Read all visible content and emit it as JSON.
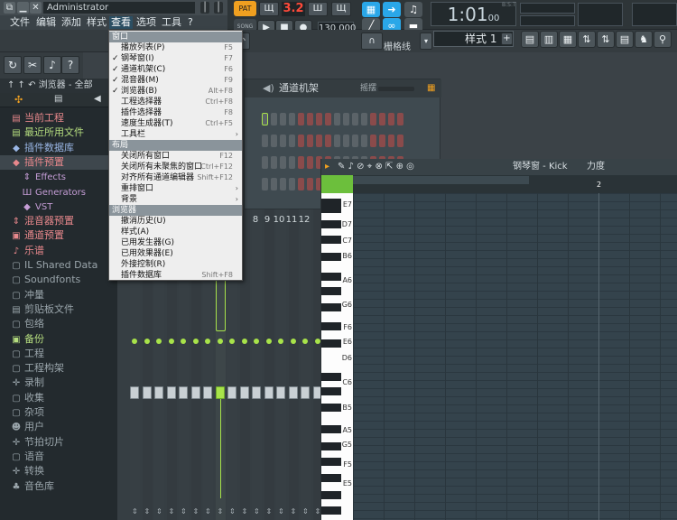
{
  "window": {
    "title": "Administrator"
  },
  "menubar": {
    "items": [
      "文件",
      "编辑",
      "添加",
      "样式",
      "查看",
      "选项",
      "工具",
      "?"
    ],
    "active": "查看"
  },
  "transport": {
    "pattern_label": "PAT",
    "song_label": "SONG",
    "tempo": "130.000",
    "pattern_number": "3.2",
    "time": "1:01",
    "time_small": "00",
    "time_caption": "B:S:T"
  },
  "snap": {
    "label": "栅格线"
  },
  "pattern_selector": {
    "label": "样式 1"
  },
  "browser": {
    "header": "浏览器 - 全部",
    "items": [
      {
        "label": "当前工程",
        "icon": "project-icon",
        "glyph": "▤",
        "color": "#e8888c"
      },
      {
        "label": "最近所用文件",
        "icon": "recent-files-icon",
        "glyph": "▤",
        "color": "#b5dd7f"
      },
      {
        "label": "插件数据库",
        "icon": "plugin-db-icon",
        "glyph": "◆",
        "color": "#9ab7e6"
      },
      {
        "label": "插件预置",
        "icon": "plugin-preset-icon",
        "glyph": "◆",
        "color": "#e8888c"
      },
      {
        "label": "Effects",
        "icon": "effects-icon",
        "glyph": "⇕",
        "color": "#c59dd6",
        "indent": true
      },
      {
        "label": "Generators",
        "icon": "generators-icon",
        "glyph": "Ш",
        "color": "#c59dd6",
        "indent": true
      },
      {
        "label": "VST",
        "icon": "vst-icon",
        "glyph": "◆",
        "color": "#c59dd6",
        "indent": true
      },
      {
        "label": "混音器预置",
        "icon": "mixer-preset-icon",
        "glyph": "⇕",
        "color": "#e8888c"
      },
      {
        "label": "通道预置",
        "icon": "channel-preset-icon",
        "glyph": "▣",
        "color": "#e8888c"
      },
      {
        "label": "乐谱",
        "icon": "score-icon",
        "glyph": "♪",
        "color": "#e8888c"
      },
      {
        "label": "IL Shared Data",
        "icon": "folder-icon",
        "glyph": "▢",
        "color": "#9aa5ab"
      },
      {
        "label": "Soundfonts",
        "icon": "folder-icon",
        "glyph": "▢",
        "color": "#9aa5ab"
      },
      {
        "label": "冲量",
        "icon": "folder-icon",
        "glyph": "▢",
        "color": "#9aa5ab"
      },
      {
        "label": "剪贴板文件",
        "icon": "clipboard-icon",
        "glyph": "▤",
        "color": "#9aa5ab"
      },
      {
        "label": "包络",
        "icon": "folder-icon",
        "glyph": "▢",
        "color": "#9aa5ab"
      },
      {
        "label": "备份",
        "icon": "backup-icon",
        "glyph": "▣",
        "color": "#b5dd7f"
      },
      {
        "label": "工程",
        "icon": "folder-icon",
        "glyph": "▢",
        "color": "#9aa5ab"
      },
      {
        "label": "工程构架",
        "icon": "folder-icon",
        "glyph": "▢",
        "color": "#9aa5ab"
      },
      {
        "label": "录制",
        "icon": "record-icon",
        "glyph": "✛",
        "color": "#9aa5ab"
      },
      {
        "label": "收集",
        "icon": "folder-icon",
        "glyph": "▢",
        "color": "#9aa5ab"
      },
      {
        "label": "杂项",
        "icon": "folder-icon",
        "glyph": "▢",
        "color": "#9aa5ab"
      },
      {
        "label": "用户",
        "icon": "user-icon",
        "glyph": "☻",
        "color": "#9aa5ab"
      },
      {
        "label": "节拍切片",
        "icon": "slice-icon",
        "glyph": "✛",
        "color": "#9aa5ab"
      },
      {
        "label": "语音",
        "icon": "folder-icon",
        "glyph": "▢",
        "color": "#9aa5ab"
      },
      {
        "label": "转换",
        "icon": "convert-icon",
        "glyph": "✛",
        "color": "#9aa5ab"
      },
      {
        "label": "音色库",
        "icon": "sound-library-icon",
        "glyph": "♣",
        "color": "#9aa5ab"
      }
    ]
  },
  "channel_rack": {
    "title": "通道机架",
    "swing": "摇摆"
  },
  "mixer": {
    "track_numbers": [
      "8",
      "9",
      "10",
      "11",
      "12"
    ]
  },
  "piano_roll": {
    "title": "钢琴窗 - Kick",
    "velocity": "力度",
    "bar_marker": "2",
    "note_labels": [
      "E7",
      "D7",
      "C7",
      "B6",
      "A6",
      "G6",
      "F6",
      "E6",
      "D6",
      "C6",
      "B5",
      "A5",
      "G5",
      "F5",
      "E5"
    ]
  },
  "dropdown": {
    "sections": [
      {
        "title": "窗口",
        "items": [
          {
            "label": "播放列表(P)",
            "shortcut": "F5",
            "checked": false
          },
          {
            "label": "钢琴窗(I)",
            "shortcut": "F7",
            "checked": true
          },
          {
            "label": "通道机架(C)",
            "shortcut": "F6",
            "checked": true
          },
          {
            "label": "混音器(M)",
            "shortcut": "F9",
            "checked": true
          },
          {
            "label": "浏览器(B)",
            "shortcut": "Alt+F8",
            "checked": true
          },
          {
            "label": "工程选择器",
            "shortcut": "Ctrl+F8",
            "checked": false
          },
          {
            "label": "插件选择器",
            "shortcut": "F8",
            "checked": false
          },
          {
            "label": "速度生成器(T)",
            "shortcut": "Ctrl+F5",
            "checked": false
          },
          {
            "label": "工具栏",
            "shortcut": "",
            "checked": false,
            "submenu": true
          }
        ]
      },
      {
        "title": "布局",
        "items": [
          {
            "label": "关闭所有窗口",
            "shortcut": "F12",
            "checked": false
          },
          {
            "label": "关闭所有未聚焦的窗口",
            "shortcut": "Ctrl+F12",
            "checked": false
          },
          {
            "label": "对齐所有通道编辑器",
            "shortcut": "Shift+F12",
            "checked": false
          },
          {
            "label": "重排窗口",
            "shortcut": "",
            "checked": false,
            "submenu": true
          },
          {
            "label": "背景",
            "shortcut": "",
            "checked": false,
            "submenu": true
          }
        ]
      },
      {
        "title": "浏览器",
        "items": [
          {
            "label": "撤消历史(U)",
            "shortcut": "",
            "checked": false
          },
          {
            "label": "样式(A)",
            "shortcut": "",
            "checked": false
          },
          {
            "label": "已用发生器(G)",
            "shortcut": "",
            "checked": false
          },
          {
            "label": "已用效果器(E)",
            "shortcut": "",
            "checked": false
          },
          {
            "label": "外接控制(R)",
            "shortcut": "",
            "checked": false
          },
          {
            "label": "插件数据库",
            "shortcut": "Shift+F8",
            "checked": false
          }
        ]
      }
    ]
  },
  "colors": {
    "accent_orange": "#f0a020",
    "accent_blue": "#2aa7e8",
    "tempo_red": "#ff4a3a",
    "fader_green": "#a8e34a"
  }
}
